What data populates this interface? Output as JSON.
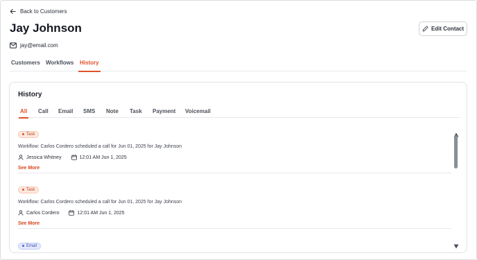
{
  "nav": {
    "back_label": "Back to Customers"
  },
  "contact": {
    "name": "Jay Johnson",
    "email": "jay@email.com",
    "edit_label": "Edit Contact"
  },
  "tabs": [
    {
      "label": "Customers",
      "active": false
    },
    {
      "label": "Workflows",
      "active": false
    },
    {
      "label": "History",
      "active": true
    }
  ],
  "history": {
    "title": "History",
    "filters": [
      {
        "label": "All",
        "active": true
      },
      {
        "label": "Call",
        "active": false
      },
      {
        "label": "Email",
        "active": false
      },
      {
        "label": "SMS",
        "active": false
      },
      {
        "label": "Note",
        "active": false
      },
      {
        "label": "Task",
        "active": false
      },
      {
        "label": "Payment",
        "active": false
      },
      {
        "label": "Voicemail",
        "active": false
      }
    ],
    "entries": [
      {
        "tag": "Task",
        "description": "Workflow: Carlos Cordero scheduled a call for Jun 01, 2025 for Jay Johnson",
        "user": "Jessica Whitney",
        "datetime": "12:01 AM Jun 1, 2025",
        "see_more": "See More"
      },
      {
        "tag": "Task",
        "description": "Workflow: Carlos Cordero scheduled a call for Jun 01, 2025 for Jay Johnson",
        "user": "Carlos Cordero",
        "datetime": "12:01 AM Jun 1, 2025",
        "see_more": "See More"
      },
      {
        "tag": "Email"
      }
    ]
  },
  "colors": {
    "accent": "#e0522a",
    "task_tag_bg": "#fde9df",
    "email_tag_bg": "#e3e8fb",
    "scroll_thumb": "#8a8e96"
  },
  "icons": {
    "back": "arrow-left-icon",
    "edit": "pencil-icon",
    "email": "envelope-icon",
    "user": "user-icon",
    "date": "calendar-icon",
    "scroll_up": "triangle-up-icon",
    "scroll_down": "triangle-down-icon"
  }
}
